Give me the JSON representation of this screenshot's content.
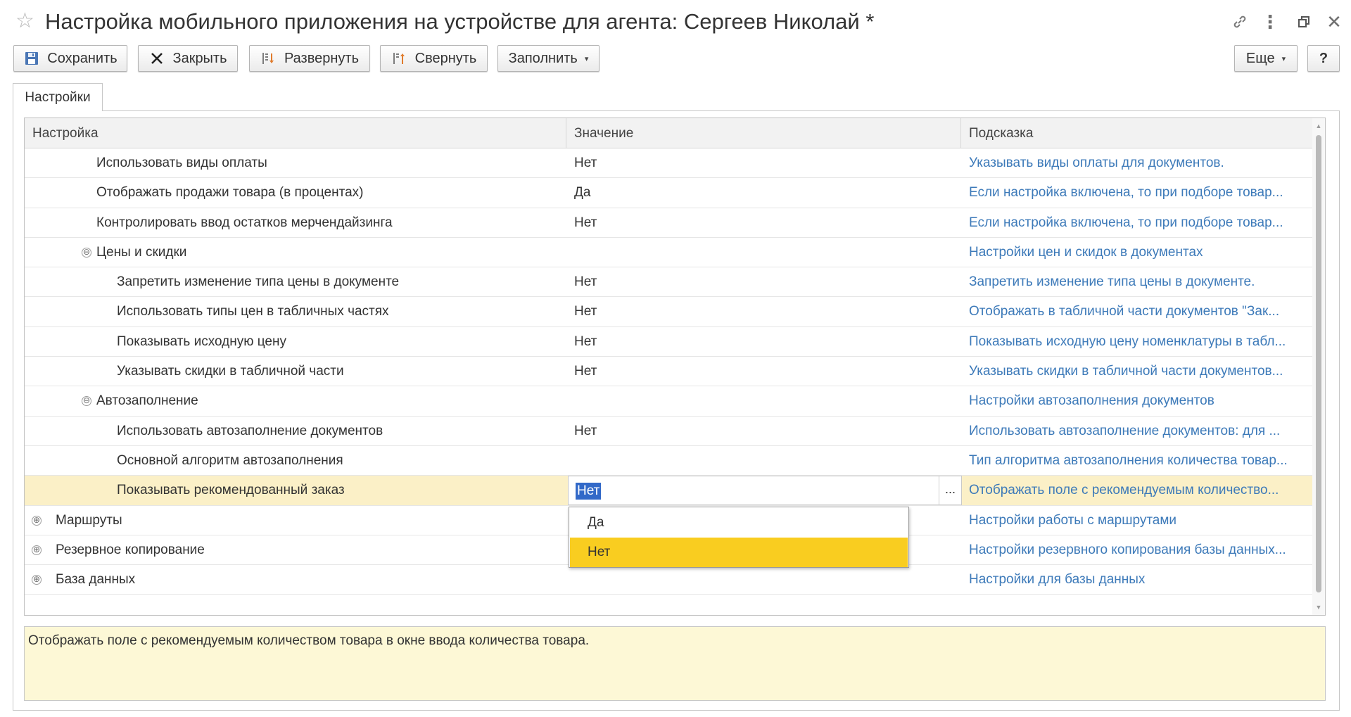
{
  "window": {
    "title": "Настройка мобильного приложения на устройстве для агента: Сергеев Николай *",
    "icons": [
      "star-icon",
      "link-icon",
      "more-vert-icon",
      "restore-icon",
      "close-icon"
    ]
  },
  "toolbar": {
    "save_label": "Сохранить",
    "close_label": "Закрыть",
    "expand_label": "Развернуть",
    "collapse_label": "Свернуть",
    "fill_label": "Заполнить",
    "more_label": "Еще",
    "help_label": "?"
  },
  "tabs": [
    {
      "label": "Настройки"
    }
  ],
  "table": {
    "columns": [
      "Настройка",
      "Значение",
      "Подсказка"
    ],
    "rows": [
      {
        "name": "Использовать виды оплаты",
        "value": "Нет",
        "hint": "Указывать виды оплаты для документов."
      },
      {
        "name": "Отображать продажи товара (в процентах)",
        "value": "Да",
        "hint": "Если настройка включена, то при подборе товар..."
      },
      {
        "name": "Контролировать ввод остатков мерчендайзинга",
        "value": "Нет",
        "hint": "Если настройка включена, то при подборе товар..."
      },
      {
        "name": "Цены и скидки",
        "value": "",
        "hint": "Настройки цен и скидок в документах",
        "toggle": "⊖"
      },
      {
        "name": "Запретить изменение типа цены в документе",
        "value": "Нет",
        "hint": "Запретить изменение типа цены в документе."
      },
      {
        "name": "Использовать типы цен в табличных частях",
        "value": "Нет",
        "hint": "Отображать в табличной части документов \"Зак..."
      },
      {
        "name": "Показывать исходную цену",
        "value": "Нет",
        "hint": "Показывать исходную цену номенклатуры в табл..."
      },
      {
        "name": "Указывать скидки в табличной части",
        "value": "Нет",
        "hint": "Указывать скидки в табличной части документов..."
      },
      {
        "name": "Автозаполнение",
        "value": "",
        "hint": "Настройки автозаполнения документов",
        "toggle": "⊖"
      },
      {
        "name": "Использовать автозаполнение документов",
        "value": "Нет",
        "hint": "Использовать автозаполнение документов: для ..."
      },
      {
        "name": "Основной алгоритм автозаполнения",
        "value": "",
        "hint": "Тип алгоритма автозаполнения количества товар..."
      },
      {
        "name": "Показывать рекомендованный заказ",
        "value": "Нет",
        "hint": "Отображать поле с рекомендуемым количество...",
        "selected": true
      },
      {
        "name": "Маршруты",
        "value": "",
        "hint": "Настройки работы с маршрутами",
        "toggle": "⊕"
      },
      {
        "name": "Резервное копирование",
        "value": "",
        "hint": "Настройки резервного копирования базы данных...",
        "toggle": "⊕"
      },
      {
        "name": "База данных",
        "value": "",
        "hint": "Настройки для базы данных",
        "toggle": "⊕"
      }
    ]
  },
  "editor": {
    "value": "Нет",
    "button_label": "..."
  },
  "dropdown": {
    "options": [
      "Да",
      "Нет"
    ],
    "selected": "Нет"
  },
  "hint_box": {
    "text": "Отображать поле с рекомендуемым количеством товара в окне ввода количества товара."
  },
  "colors": {
    "hint_link": "#3d7ab9",
    "selected_row": "#fbf0c7",
    "dropdown_highlight": "#f9cd20",
    "hint_box_bg": "#fdf8d6",
    "text_selection": "#3269c8"
  }
}
